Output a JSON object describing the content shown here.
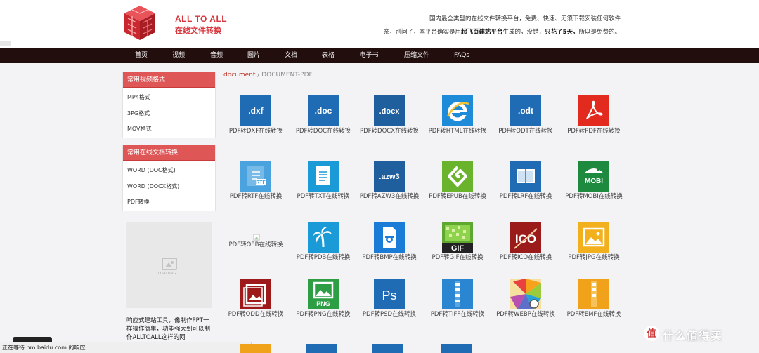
{
  "header": {
    "logo_en": "ALL TO ALL",
    "logo_cn": "在线文件转换",
    "desc_line1": "国内最全类型的在线文件转换平台，免费、快速、无须下载安装任何软件",
    "desc_line2_a": "亲，别问了，本平台确实是用",
    "desc_line2_b": "起飞页建站平台",
    "desc_line2_c": "生成的，没错，",
    "desc_line2_d": "只花了5天。",
    "desc_line2_e": "所以是免费的。"
  },
  "nav": [
    "首页",
    "视频",
    "音频",
    "图片",
    "文档",
    "表格",
    "电子书",
    "压缩文件",
    "FAQs"
  ],
  "sidebar": {
    "video": {
      "title": "常用视频格式",
      "items": [
        "MP4格式",
        "3PG格式",
        "MOV格式"
      ]
    },
    "doc": {
      "title": "常用在线文档转换",
      "items": [
        "WORD (DOC格式)",
        "WORD (DOCX格式)",
        "PDF转换"
      ]
    }
  },
  "ad": {
    "loading": "LOADING...",
    "text": "响应式建站工具，像制作PPT一样操作简单，功能强大到可以制作ALLTOALL这样的网"
  },
  "breadcrumb": {
    "link": "document",
    "sep": " / ",
    "current": "DOCUMENT-PDF"
  },
  "tiles": [
    {
      "label": "PDF转DXF在线转换",
      "icon": "dxf-icon",
      "text": ".dxf"
    },
    {
      "label": "PDF转DOC在线转换",
      "icon": "doc-icon",
      "text": ".doc"
    },
    {
      "label": "PDF转DOCX在线转换",
      "icon": "docx-icon",
      "text": ".docx"
    },
    {
      "label": "PDF转HTML在线转换",
      "icon": "ie-icon",
      "text": "e"
    },
    {
      "label": "PDF转ODT在线转换",
      "icon": "odt-icon",
      "text": ".odt"
    },
    {
      "label": "PDF转PDF在线转换",
      "icon": "pdf-acrobat-icon",
      "text": ""
    },
    {
      "label": "PDF转RTF在线转换",
      "icon": "rtf-icon",
      "text": "RTF"
    },
    {
      "label": "PDF转TXT在线转换",
      "icon": "txt-icon",
      "text": ""
    },
    {
      "label": "PDF转AZW3在线转换",
      "icon": "azw3-icon",
      "text": ".azw3"
    },
    {
      "label": "PDF转EPUB在线转换",
      "icon": "epub-icon",
      "text": ""
    },
    {
      "label": "PDF转LRF在线转换",
      "icon": "lrf-icon",
      "text": ""
    },
    {
      "label": "PDF转MOBI在线转换",
      "icon": "mobi-icon",
      "text": "MOBI"
    },
    {
      "label": "PDF转OEB在线转换",
      "icon": "broken-image-icon",
      "text": ""
    },
    {
      "label": "PDF转PDB在线转换",
      "icon": "palm-icon",
      "text": ""
    },
    {
      "label": "PDF转BMP在线转换",
      "icon": "bmp-icon",
      "text": ""
    },
    {
      "label": "PDF转GIF在线转换",
      "icon": "gif-icon",
      "text": "GIF"
    },
    {
      "label": "PDF转ICO在线转换",
      "icon": "ico-icon",
      "text": "ICO"
    },
    {
      "label": "PDF转JPG在线转换",
      "icon": "jpg-icon",
      "text": ""
    },
    {
      "label": "PDF转ODD在线转换",
      "icon": "odd-icon",
      "text": ""
    },
    {
      "label": "PDF转PNG在线转换",
      "icon": "png-icon",
      "text": "PNG"
    },
    {
      "label": "PDF转PSD在线转换",
      "icon": "psd-icon",
      "text": "Ps"
    },
    {
      "label": "PDF转TIFF在线转换",
      "icon": "tiff-icon",
      "text": ""
    },
    {
      "label": "PDF转WEBP在线转换",
      "icon": "webp-icon",
      "text": ""
    },
    {
      "label": "PDF转EMF在线转换",
      "icon": "emf-icon",
      "text": ""
    }
  ],
  "status": "正在等待 hm.baidu.com 的响应...",
  "watermark": "值 什么值得买",
  "colors": {
    "accent": "#df5656",
    "nav_bg": "#230e0e",
    "logo": "#d8353c",
    "icon_blue": "#1f6cb5"
  }
}
